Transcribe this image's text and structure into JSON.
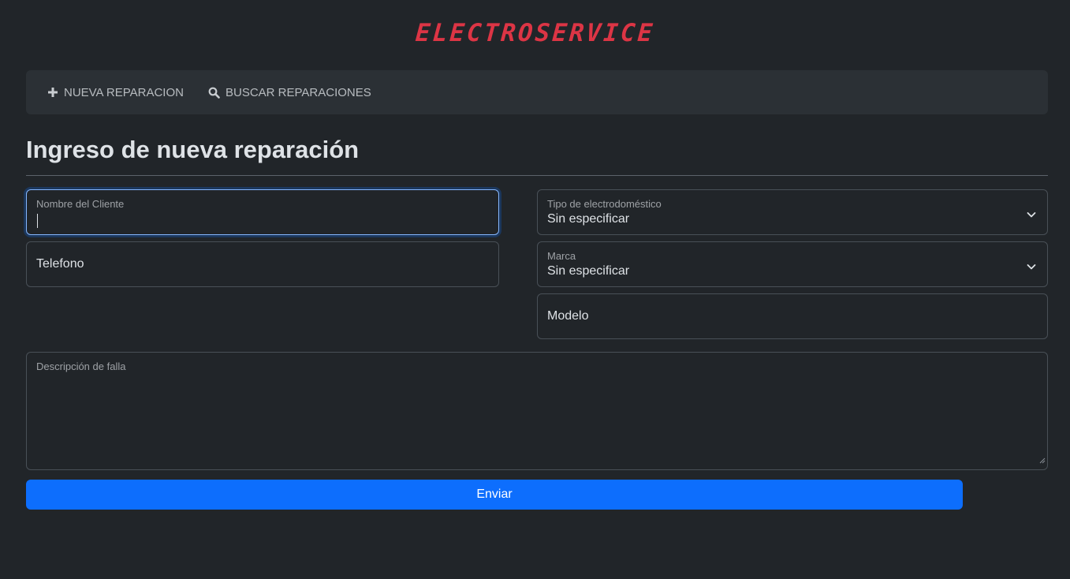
{
  "brand": {
    "logo_text": "ELECTROSERVICE",
    "color": "#dc3545"
  },
  "nav": {
    "items": [
      {
        "label": "NUEVA REPARACION",
        "icon": "plus-icon"
      },
      {
        "label": "BUSCAR REPARACIONES",
        "icon": "search-icon"
      }
    ]
  },
  "page": {
    "title": "Ingreso de nueva reparación"
  },
  "form": {
    "client_name": {
      "label": "Nombre del Cliente",
      "value": ""
    },
    "phone": {
      "placeholder": "Telefono"
    },
    "appliance_type": {
      "label": "Tipo de electrodoméstico",
      "value": "Sin especificar"
    },
    "brand": {
      "label": "Marca",
      "value": "Sin especificar"
    },
    "model": {
      "placeholder": "Modelo"
    },
    "fault_description": {
      "label": "Descripción de falla",
      "value": ""
    },
    "submit_label": "Enviar"
  },
  "colors": {
    "background": "#212529",
    "navbar": "#2b3035",
    "primary": "#0d6efd",
    "focus": "#86b7fe"
  }
}
